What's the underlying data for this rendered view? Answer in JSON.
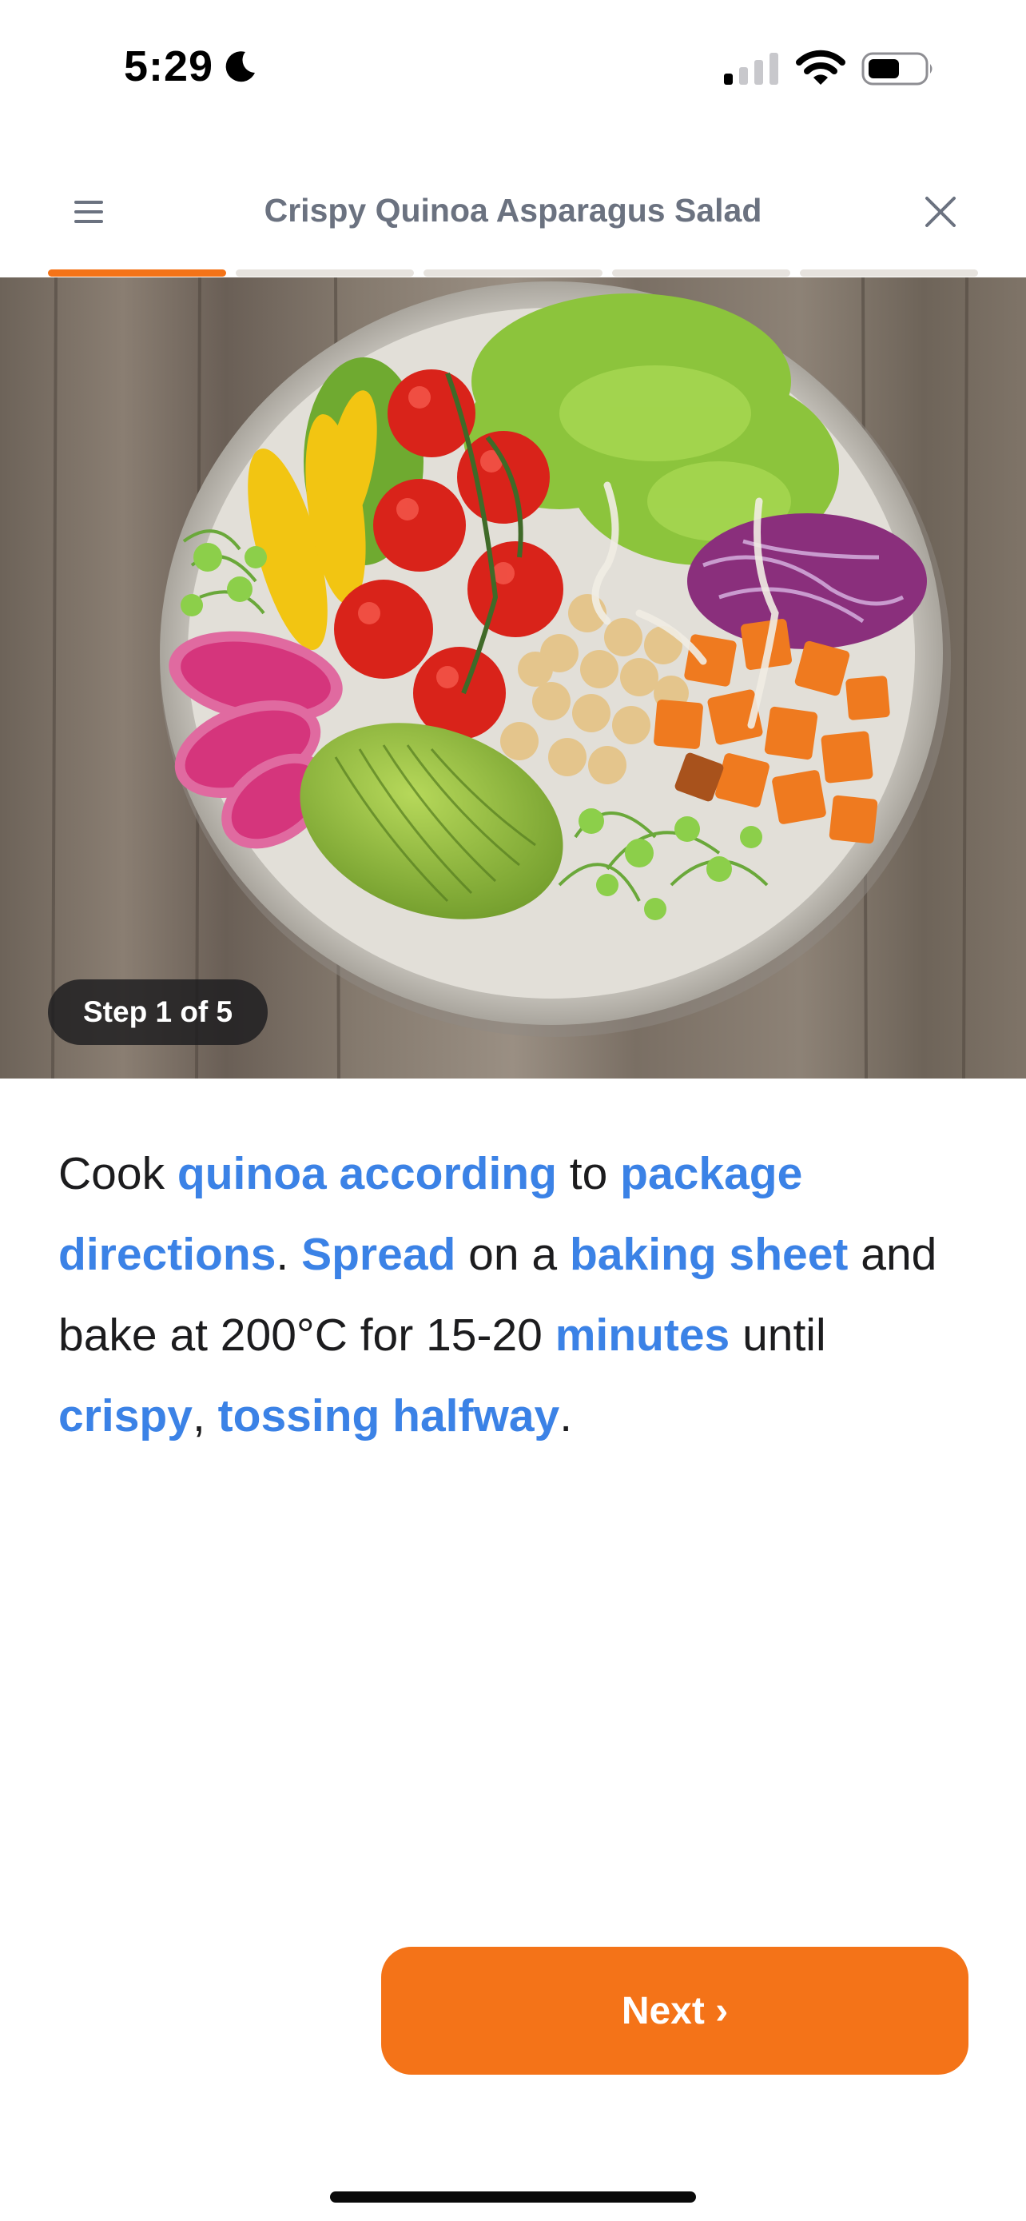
{
  "status_bar": {
    "time": "5:29",
    "icons": [
      "moon-icon",
      "cellular-signal-icon",
      "wifi-icon",
      "battery-icon"
    ]
  },
  "header": {
    "title": "Crispy Quinoa Asparagus Salad",
    "menu_icon": "menu-icon",
    "close_icon": "close-icon"
  },
  "progress": {
    "total_steps": 5,
    "current_step": 1,
    "active_color": "#f47318",
    "inactive_color": "#e7e3de"
  },
  "hero": {
    "step_badge": "Step 1 of 5"
  },
  "instruction": {
    "segments": [
      {
        "text": "Cook ",
        "term": false
      },
      {
        "text": "quinoa according",
        "term": true
      },
      {
        "text": " to ",
        "term": false
      },
      {
        "text": "package directions",
        "term": true
      },
      {
        "text": ". ",
        "term": false
      },
      {
        "text": "Spread",
        "term": true
      },
      {
        "text": " on a ",
        "term": false
      },
      {
        "text": "baking sheet",
        "term": true
      },
      {
        "text": " and bake at 200°C for 15-20 ",
        "term": false
      },
      {
        "text": "minutes",
        "term": true
      },
      {
        "text": " until ",
        "term": false
      },
      {
        "text": "crispy",
        "term": true
      },
      {
        "text": ", ",
        "term": false
      },
      {
        "text": "tossing halfway",
        "term": true
      },
      {
        "text": ".",
        "term": false
      }
    ],
    "term_color": "#3b82e6"
  },
  "footer": {
    "next_label": "Next ›",
    "button_color": "#f47318"
  }
}
